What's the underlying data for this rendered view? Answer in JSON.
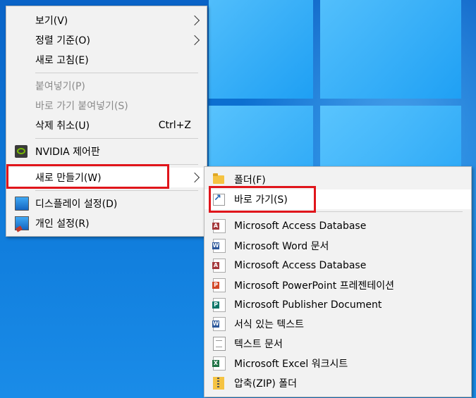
{
  "main_menu": {
    "items": [
      {
        "label": "보기(V)"
      },
      {
        "label": "정렬 기준(O)"
      },
      {
        "label": "새로 고침(E)"
      },
      {
        "label": "붙여넣기(P)"
      },
      {
        "label": "바로 가기 붙여넣기(S)"
      },
      {
        "label": "삭제 취소(U)",
        "shortcut": "Ctrl+Z"
      },
      {
        "label": "NVIDIA 제어판",
        "icon": "nvidia-icon"
      },
      {
        "label": "새로 만들기(W)"
      },
      {
        "label": "디스플레이 설정(D)",
        "icon": "display-icon"
      },
      {
        "label": "개인 설정(R)",
        "icon": "personalize-icon"
      }
    ]
  },
  "sub_menu": {
    "items": [
      {
        "label": "폴더(F)",
        "icon": "folder-icon"
      },
      {
        "label": "바로 가기(S)",
        "icon": "shortcut-icon"
      },
      {
        "label": "Microsoft Access Database",
        "icon": "access-icon"
      },
      {
        "label": "Microsoft Word 문서",
        "icon": "word-icon"
      },
      {
        "label": "Microsoft Access Database",
        "icon": "access-icon"
      },
      {
        "label": "Microsoft PowerPoint 프레젠테이션",
        "icon": "powerpoint-icon"
      },
      {
        "label": "Microsoft Publisher Document",
        "icon": "publisher-icon"
      },
      {
        "label": "서식 있는 텍스트",
        "icon": "wordpad-icon"
      },
      {
        "label": "텍스트 문서",
        "icon": "text-document-icon"
      },
      {
        "label": "Microsoft Excel 워크시트",
        "icon": "excel-icon"
      },
      {
        "label": "압축(ZIP) 폴더",
        "icon": "zip-folder-icon"
      }
    ]
  },
  "colors": {
    "highlight": "#e0151b",
    "access": "#a4373a",
    "word": "#2b579a",
    "powerpoint": "#d24726",
    "publisher": "#077568",
    "excel": "#217346"
  }
}
